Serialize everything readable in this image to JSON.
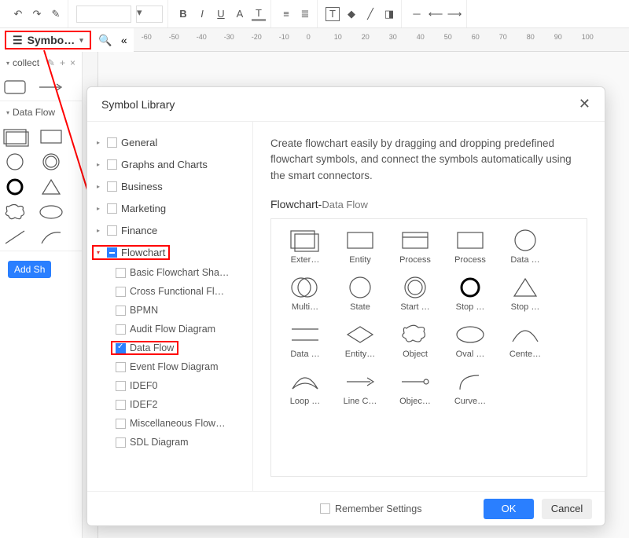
{
  "row2": {
    "symbol_btn_label": "Symbo…"
  },
  "left": {
    "collect_label": "collect",
    "dataflow_label": "Data Flow",
    "add_shape_btn": "Add Sh"
  },
  "ruler_marks": [
    "-60",
    "-50",
    "-40",
    "-30",
    "-20",
    "-10",
    "0",
    "10",
    "20",
    "30",
    "40",
    "50",
    "60",
    "70",
    "80",
    "90",
    "100"
  ],
  "modal": {
    "title": "Symbol Library",
    "tree": {
      "top": [
        "General",
        "Graphs and Charts",
        "Business",
        "Marketing",
        "Finance"
      ],
      "flowchart_label": "Flowchart",
      "flowchart_children": [
        "Basic Flowchart Sha…",
        "Cross Functional Fl…",
        "BPMN",
        "Audit Flow Diagram",
        "Data Flow",
        "Event Flow Diagram",
        "IDEF0",
        "IDEF2",
        "Miscellaneous Flow…",
        "SDL Diagram"
      ]
    },
    "desc": "Create flowchart easily by dragging and dropping predefined flowchart symbols, and connect the symbols automatically using the smart connectors.",
    "preview_title_main": "Flowchart-",
    "preview_title_sub": "Data Flow",
    "shapes": [
      "Exter…",
      "Entity",
      "Process",
      "Process",
      "Data …",
      "Multi…",
      "State",
      "Start …",
      "Stop …",
      "Stop …",
      "Data …",
      "Entity…",
      "Object",
      "Oval …",
      "Cente…",
      "Loop …",
      "Line C…",
      "Objec…",
      "Curve…"
    ],
    "remember": "Remember Settings",
    "ok": "OK",
    "cancel": "Cancel"
  }
}
